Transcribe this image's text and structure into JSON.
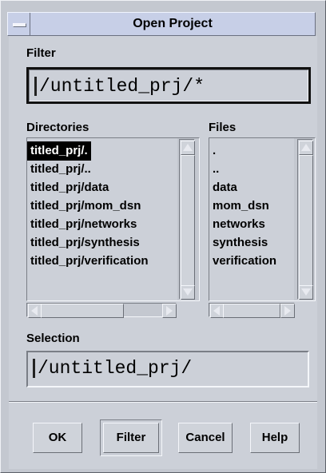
{
  "window": {
    "title": "Open Project"
  },
  "filter": {
    "label": "Filter",
    "value": "/untitled_prj/*"
  },
  "directories": {
    "label": "Directories",
    "items": [
      {
        "label": "titled_prj/.",
        "selected": true
      },
      {
        "label": "titled_prj/.."
      },
      {
        "label": "titled_prj/data"
      },
      {
        "label": "titled_prj/mom_dsn"
      },
      {
        "label": "titled_prj/networks"
      },
      {
        "label": "titled_prj/synthesis"
      },
      {
        "label": "titled_prj/verification"
      }
    ]
  },
  "files": {
    "label": "Files",
    "items": [
      {
        "label": "."
      },
      {
        "label": ".."
      },
      {
        "label": "data"
      },
      {
        "label": "mom_dsn"
      },
      {
        "label": "networks"
      },
      {
        "label": "synthesis"
      },
      {
        "label": "verification"
      }
    ]
  },
  "selection": {
    "label": "Selection",
    "value": "/untitled_prj/"
  },
  "buttons": {
    "ok": "OK",
    "filter": "Filter",
    "cancel": "Cancel",
    "help": "Help"
  }
}
